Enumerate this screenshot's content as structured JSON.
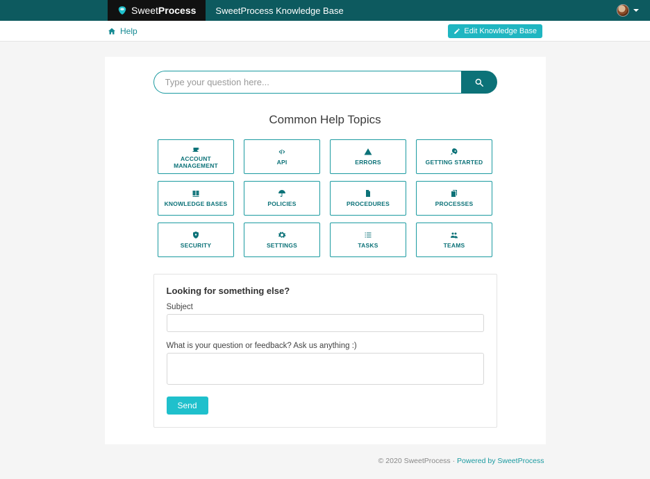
{
  "colors": {
    "teal": "#0c7278",
    "accent": "#1fc0cc"
  },
  "navbar": {
    "brand_sweet": "Sweet",
    "brand_process": "Process",
    "title": "SweetProcess Knowledge Base"
  },
  "breadcrumb": {
    "help": "Help"
  },
  "actions": {
    "edit_kb": "Edit Knowledge Base"
  },
  "search": {
    "placeholder": "Type your question here..."
  },
  "sections": {
    "common_topics": "Common Help Topics"
  },
  "topics": [
    {
      "icon": "coffee",
      "label": "ACCOUNT MANAGEMENT"
    },
    {
      "icon": "code",
      "label": "API"
    },
    {
      "icon": "warning",
      "label": "ERRORS"
    },
    {
      "icon": "rocket",
      "label": "GETTING STARTED"
    },
    {
      "icon": "book",
      "label": "KNOWLEDGE BASES"
    },
    {
      "icon": "umbrella",
      "label": "POLICIES"
    },
    {
      "icon": "file",
      "label": "PROCEDURES"
    },
    {
      "icon": "copy",
      "label": "PROCESSES"
    },
    {
      "icon": "shield",
      "label": "SECURITY"
    },
    {
      "icon": "gear",
      "label": "SETTINGS"
    },
    {
      "icon": "tasks",
      "label": "TASKS"
    },
    {
      "icon": "users",
      "label": "TEAMS"
    }
  ],
  "contact": {
    "heading": "Looking for something else?",
    "subject_label": "Subject",
    "body_label": "What is your question or feedback? Ask us anything :)",
    "send": "Send"
  },
  "footer": {
    "copyright": "© 2020 SweetProcess · ",
    "powered": "Powered by SweetProcess"
  }
}
